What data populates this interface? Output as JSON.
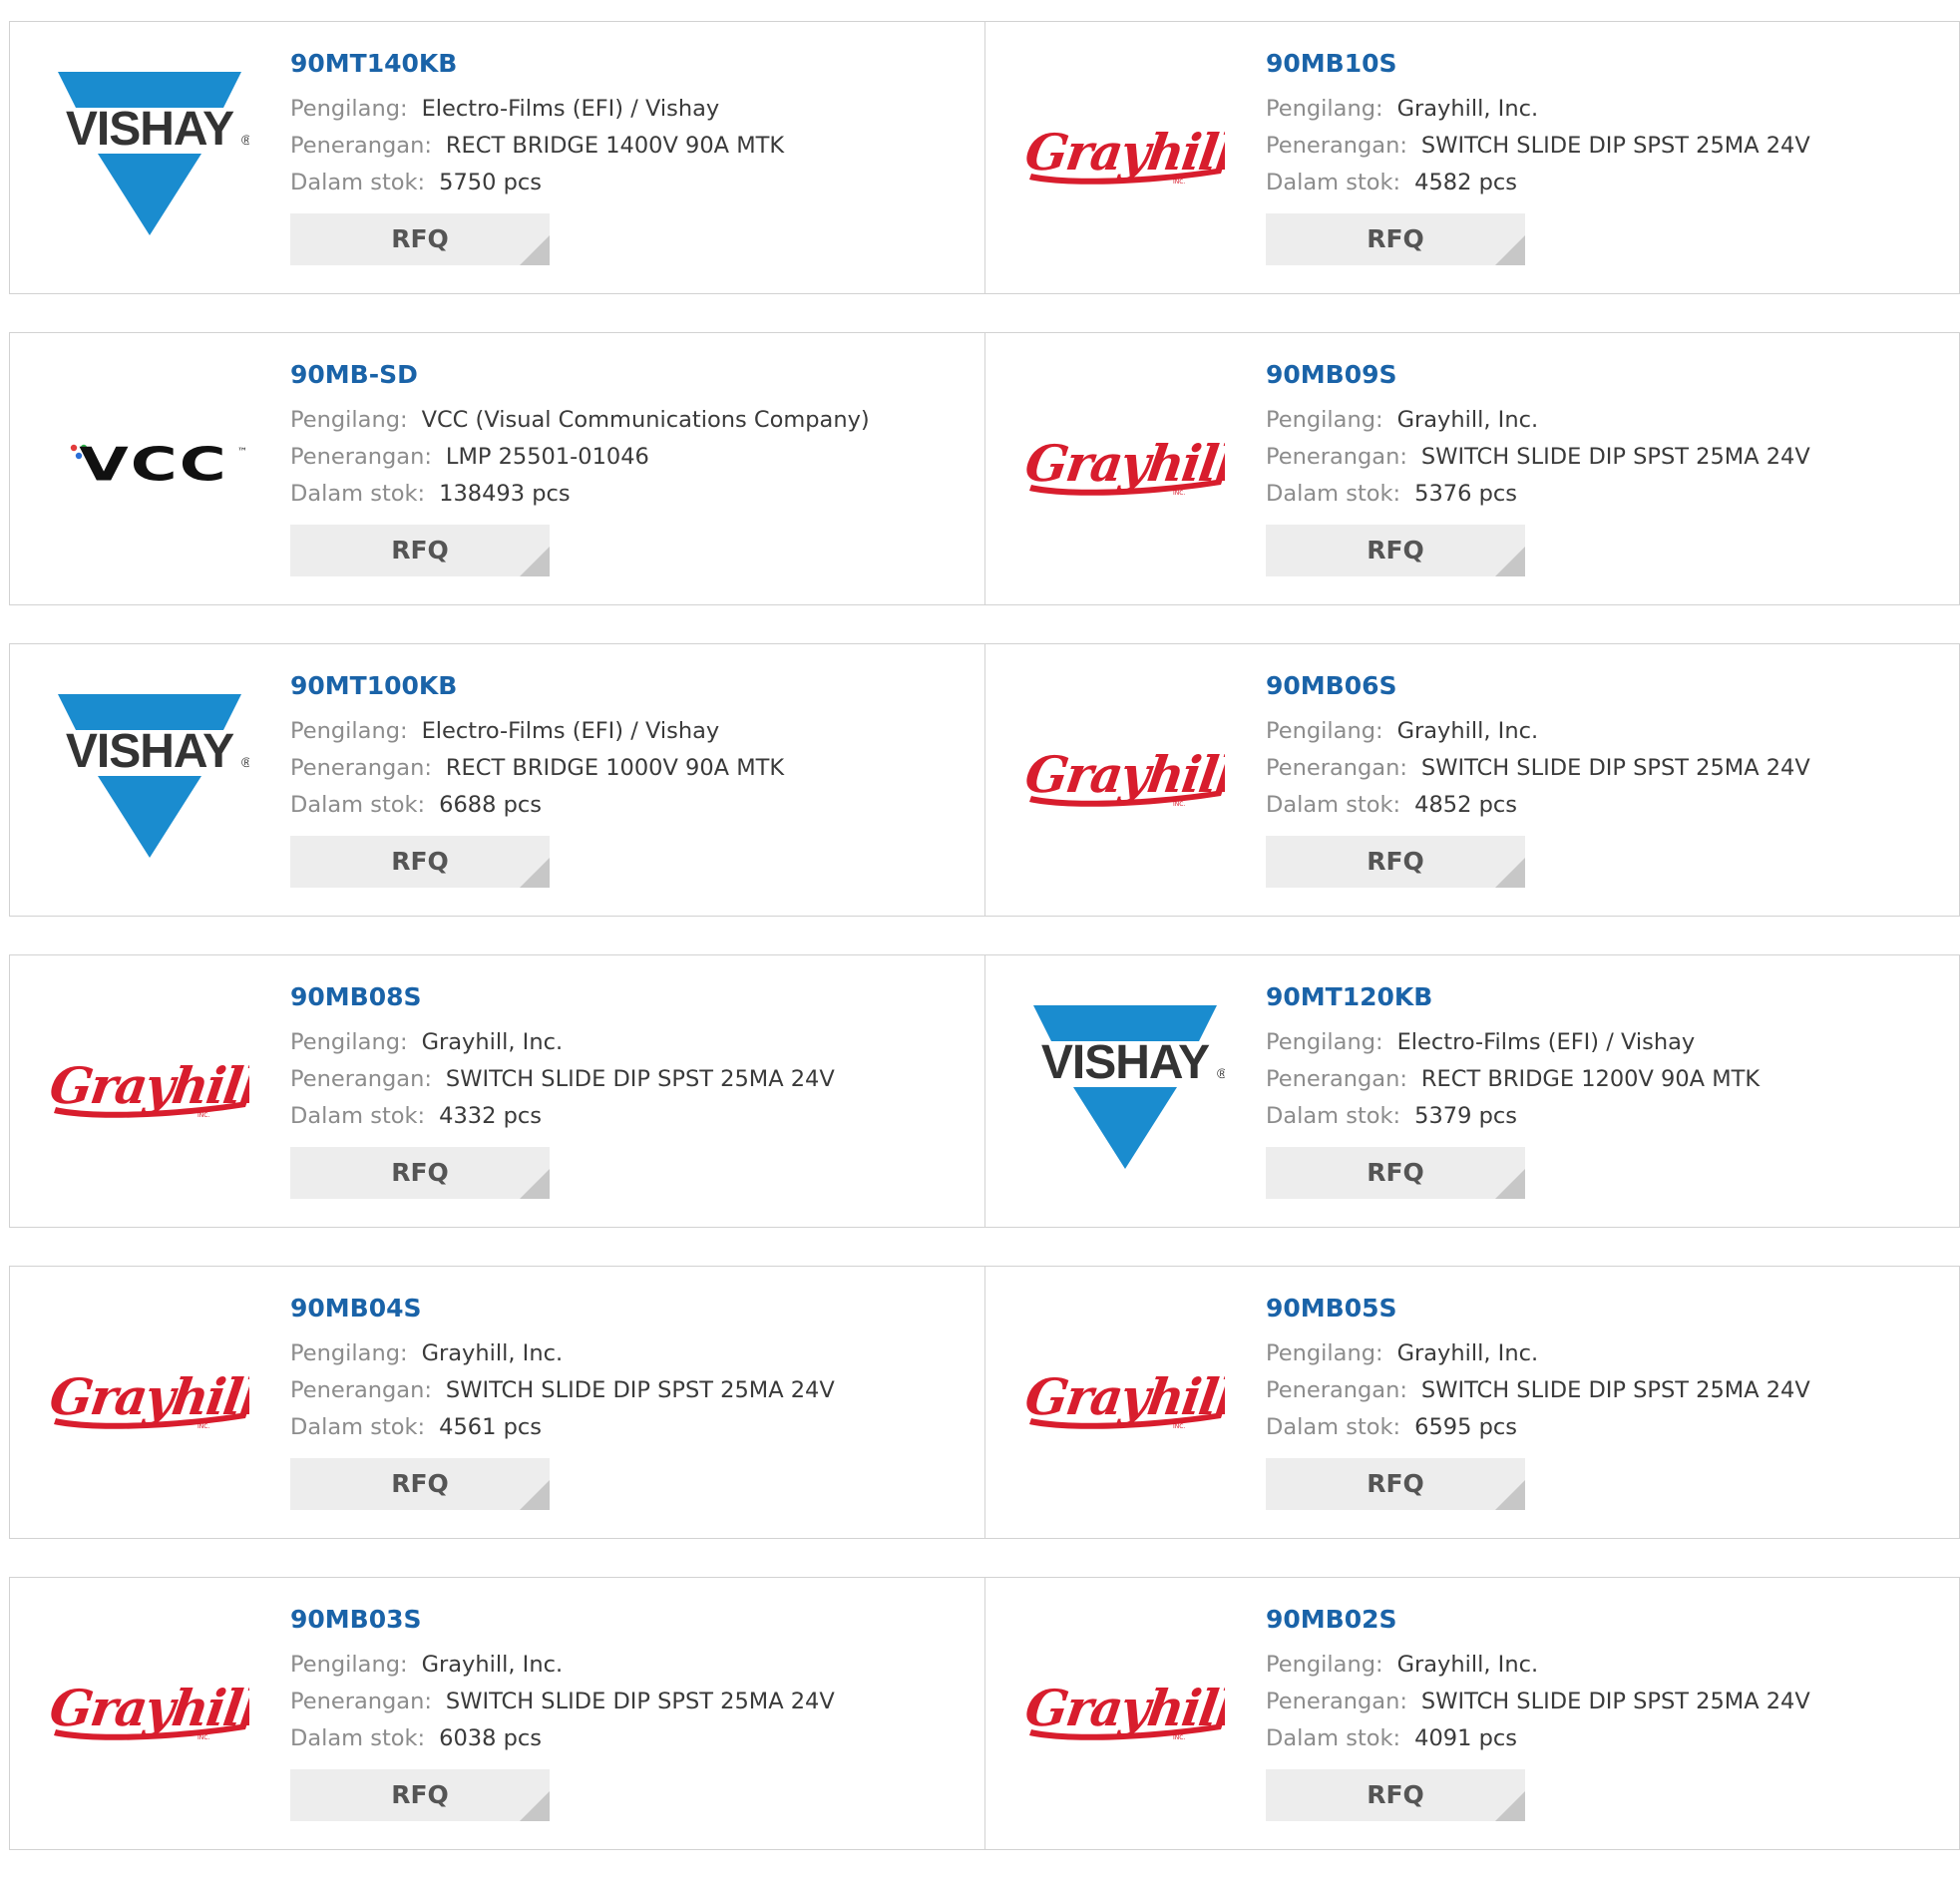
{
  "labels": {
    "manufacturer": "Pengilang:",
    "description": "Penerangan:",
    "stock": "Dalam stok:",
    "rfq": "RFQ"
  },
  "logos": {
    "vishay": {
      "text": "VISHAY",
      "mark": "®",
      "color": "#1a8ccf"
    },
    "grayhill": {
      "text": "Grayhill",
      "sub": "INC.",
      "color": "#d81d2d"
    },
    "vcc": {
      "text": "VCC",
      "tm": "™"
    }
  },
  "products": [
    {
      "part": "90MT140KB",
      "logo": "vishay",
      "manufacturer": "Electro-Films (EFI) / Vishay",
      "description": "RECT BRIDGE 1400V 90A MTK",
      "stock": "5750 pcs"
    },
    {
      "part": "90MB10S",
      "logo": "grayhill",
      "manufacturer": "Grayhill, Inc.",
      "description": "SWITCH SLIDE DIP SPST 25MA 24V",
      "stock": "4582 pcs"
    },
    {
      "part": "90MB-SD",
      "logo": "vcc",
      "manufacturer": "VCC (Visual Communications Company)",
      "description": "LMP 25501-01046",
      "stock": "138493 pcs"
    },
    {
      "part": "90MB09S",
      "logo": "grayhill",
      "manufacturer": "Grayhill, Inc.",
      "description": "SWITCH SLIDE DIP SPST 25MA 24V",
      "stock": "5376 pcs"
    },
    {
      "part": "90MT100KB",
      "logo": "vishay",
      "manufacturer": "Electro-Films (EFI) / Vishay",
      "description": "RECT BRIDGE 1000V 90A MTK",
      "stock": "6688 pcs"
    },
    {
      "part": "90MB06S",
      "logo": "grayhill",
      "manufacturer": "Grayhill, Inc.",
      "description": "SWITCH SLIDE DIP SPST 25MA 24V",
      "stock": "4852 pcs"
    },
    {
      "part": "90MB08S",
      "logo": "grayhill",
      "manufacturer": "Grayhill, Inc.",
      "description": "SWITCH SLIDE DIP SPST 25MA 24V",
      "stock": "4332 pcs"
    },
    {
      "part": "90MT120KB",
      "logo": "vishay",
      "manufacturer": "Electro-Films (EFI) / Vishay",
      "description": "RECT BRIDGE 1200V 90A MTK",
      "stock": "5379 pcs"
    },
    {
      "part": "90MB04S",
      "logo": "grayhill",
      "manufacturer": "Grayhill, Inc.",
      "description": "SWITCH SLIDE DIP SPST 25MA 24V",
      "stock": "4561 pcs"
    },
    {
      "part": "90MB05S",
      "logo": "grayhill",
      "manufacturer": "Grayhill, Inc.",
      "description": "SWITCH SLIDE DIP SPST 25MA 24V",
      "stock": "6595 pcs"
    },
    {
      "part": "90MB03S",
      "logo": "grayhill",
      "manufacturer": "Grayhill, Inc.",
      "description": "SWITCH SLIDE DIP SPST 25MA 24V",
      "stock": "6038 pcs"
    },
    {
      "part": "90MB02S",
      "logo": "grayhill",
      "manufacturer": "Grayhill, Inc.",
      "description": "SWITCH SLIDE DIP SPST 25MA 24V",
      "stock": "4091 pcs"
    }
  ]
}
